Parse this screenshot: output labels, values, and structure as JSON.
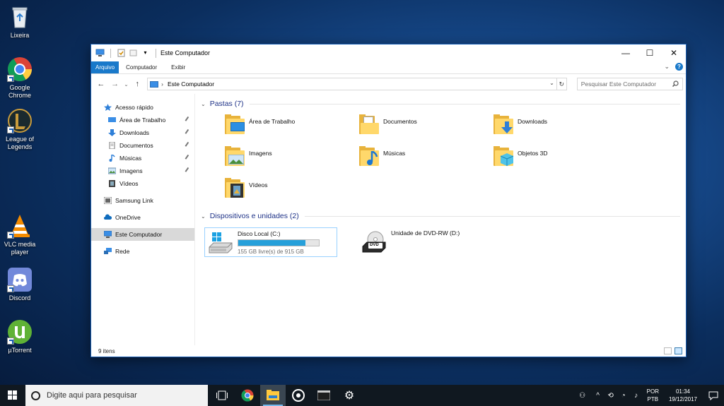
{
  "desktop": {
    "icons": [
      {
        "label": "Lixeira"
      },
      {
        "label": "Google Chrome"
      },
      {
        "label": "League of Legends"
      },
      {
        "label": "VLC media player"
      },
      {
        "label": "Discord"
      },
      {
        "label": "µTorrent"
      }
    ]
  },
  "window": {
    "title": "Este Computador",
    "controls": {
      "minimize": "—",
      "maximize": "☐",
      "close": "✕"
    },
    "ribbon_tabs": [
      "Arquivo",
      "Computador",
      "Exibir"
    ],
    "ribbon_expand": "⌄",
    "help": "?",
    "nav": {
      "back": "←",
      "forward": "→",
      "recent": "⌄",
      "up": "↑"
    },
    "address": {
      "path": "Este Computador",
      "separator": "›",
      "dropdown": "⌄",
      "refresh": "↻"
    },
    "search": {
      "placeholder": "Pesquisar Este Computador",
      "icon": "search-icon"
    },
    "nav_pane": {
      "quick_access": "Acesso rápido",
      "quick_items": [
        "Área de Trabalho",
        "Downloads",
        "Documentos",
        "Músicas",
        "Imagens",
        "Vídeos"
      ],
      "samsung": "Samsung Link",
      "onedrive": "OneDrive",
      "this_pc": "Este Computador",
      "network": "Rede"
    },
    "folders_group": {
      "header": "Pastas (7)",
      "items": [
        "Área de Trabalho",
        "Documentos",
        "Downloads",
        "Imagens",
        "Músicas",
        "Objetos 3D",
        "Vídeos"
      ]
    },
    "drives_group": {
      "header": "Dispositivos e unidades (2)",
      "items": [
        {
          "name": "Disco Local (C:)",
          "detail": "155 GB livre(s) de 915 GB",
          "used_fraction": 0.83
        },
        {
          "name": "Unidade de DVD-RW (D:)",
          "badge": "DVD"
        }
      ]
    },
    "status": "9 itens"
  },
  "taskbar": {
    "search_placeholder": "Digite aqui para pesquisar",
    "lang_top": "POR",
    "lang_bottom": "PTB",
    "time": "01:34",
    "date": "19/12/2017"
  },
  "colors": {
    "accent": "#1979ca",
    "header_text": "#1e3287",
    "capacity_fill": "#26a0da",
    "folder": "#ffd86b"
  }
}
